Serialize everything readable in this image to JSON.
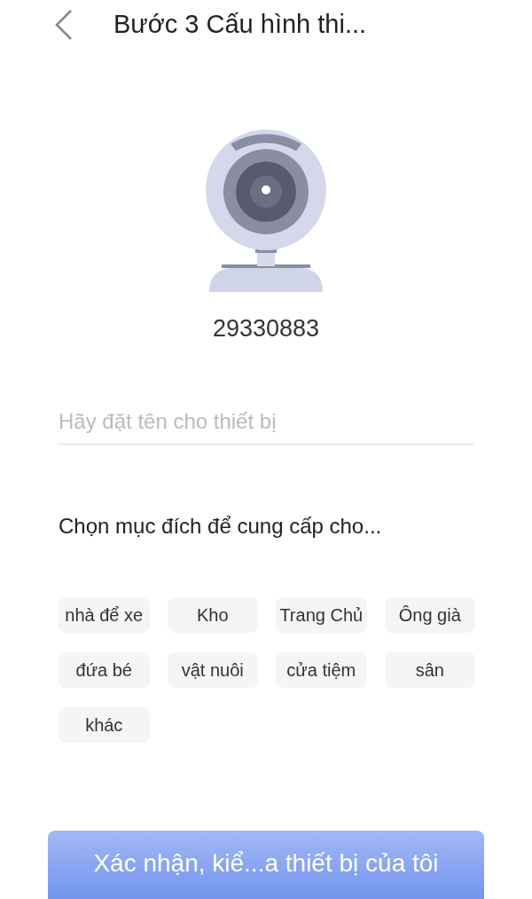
{
  "header": {
    "title": "Bước 3 Cấu hình thi..."
  },
  "device": {
    "id": "29330883"
  },
  "name_field": {
    "placeholder": "Hãy đặt tên cho thiết bị"
  },
  "purpose": {
    "heading": "Chọn mục đích để cung cấp cho...",
    "options": [
      {
        "label": "nhà để xe"
      },
      {
        "label": "Kho"
      },
      {
        "label": "Trang Chủ"
      },
      {
        "label": "Ông già"
      },
      {
        "label": "đứa bé"
      },
      {
        "label": "vật nuôi"
      },
      {
        "label": "cửa tiệm"
      },
      {
        "label": "sân"
      },
      {
        "label": "khác"
      }
    ]
  },
  "confirm_button": {
    "label": "Xác nhận, kiể...a thiết bị của tôi"
  }
}
